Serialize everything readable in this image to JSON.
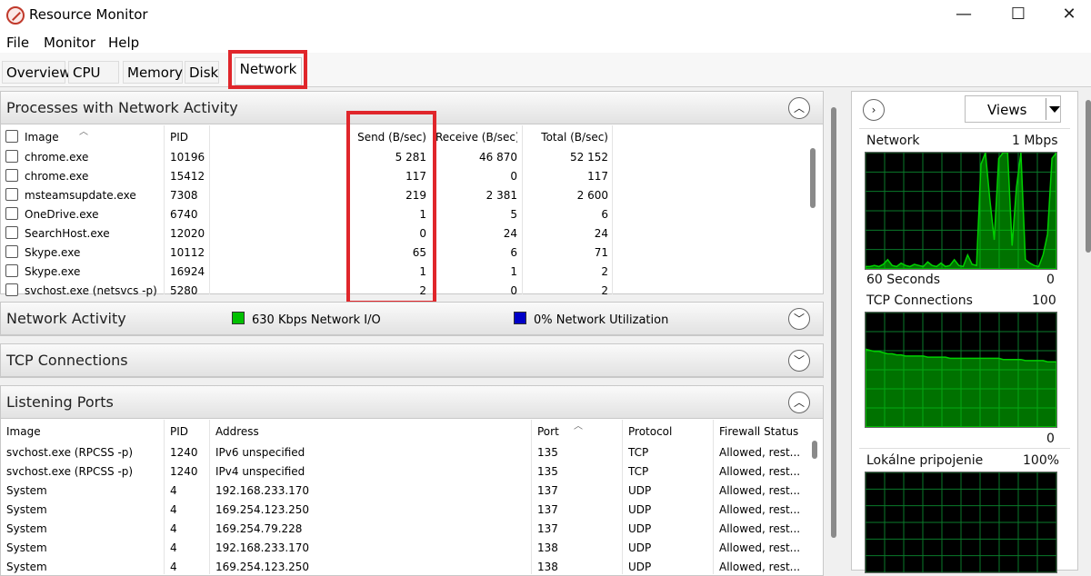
{
  "window": {
    "title": "Resource Monitor",
    "minimize": "—",
    "maximize": "☐",
    "close": "✕"
  },
  "menu": [
    "File",
    "Monitor",
    "Help"
  ],
  "tabs": [
    "Overview",
    "CPU",
    "Memory",
    "Disk",
    "Network"
  ],
  "processes": {
    "title": "Processes with Network Activity",
    "columns": [
      "Image",
      "PID",
      "Send (B/sec)",
      "Receive (B/sec)",
      "Total (B/sec)"
    ],
    "rows": [
      [
        "chrome.exe",
        "10196",
        "5 281",
        "46 870",
        "52 152"
      ],
      [
        "chrome.exe",
        "15412",
        "117",
        "0",
        "117"
      ],
      [
        "msteamsupdate.exe",
        "7308",
        "219",
        "2 381",
        "2 600"
      ],
      [
        "OneDrive.exe",
        "6740",
        "1",
        "5",
        "6"
      ],
      [
        "SearchHost.exe",
        "12020",
        "0",
        "24",
        "24"
      ],
      [
        "Skype.exe",
        "10112",
        "65",
        "6",
        "71"
      ],
      [
        "Skype.exe",
        "16924",
        "1",
        "1",
        "2"
      ],
      [
        "svchost.exe (netsvcs -p)",
        "5280",
        "2",
        "0",
        "2"
      ]
    ]
  },
  "network_activity": {
    "title": "Network Activity",
    "io": "630 Kbps Network I/O",
    "util": "0% Network Utilization",
    "io_color": "#00c000",
    "util_color": "#0000c8"
  },
  "tcp": {
    "title": "TCP Connections"
  },
  "listening": {
    "title": "Listening Ports",
    "columns": [
      "Image",
      "PID",
      "Address",
      "Port",
      "Protocol",
      "Firewall Status"
    ],
    "rows": [
      [
        "svchost.exe (RPCSS -p)",
        "1240",
        "IPv6 unspecified",
        "135",
        "TCP",
        "Allowed, rest..."
      ],
      [
        "svchost.exe (RPCSS -p)",
        "1240",
        "IPv4 unspecified",
        "135",
        "TCP",
        "Allowed, rest..."
      ],
      [
        "System",
        "4",
        "192.168.233.170",
        "137",
        "UDP",
        "Allowed, rest..."
      ],
      [
        "System",
        "4",
        "169.254.123.250",
        "137",
        "UDP",
        "Allowed, rest..."
      ],
      [
        "System",
        "4",
        "169.254.79.228",
        "137",
        "UDP",
        "Allowed, rest..."
      ],
      [
        "System",
        "4",
        "192.168.233.170",
        "138",
        "UDP",
        "Allowed, rest..."
      ],
      [
        "System",
        "4",
        "169.254.123.250",
        "138",
        "UDP",
        "Allowed, rest..."
      ]
    ]
  },
  "right": {
    "views": "Views",
    "network_label": "Network",
    "network_scale": "1 Mbps",
    "seconds": "60 Seconds",
    "network_min": "0",
    "tcp_label": "TCP Connections",
    "tcp_scale": "100",
    "tcp_min": "0",
    "local_label": "Lokálne pripojenie",
    "local_scale": "100%",
    "network_series": [
      2,
      2,
      3,
      2,
      4,
      8,
      3,
      2,
      5,
      3,
      2,
      4,
      3,
      2,
      6,
      3,
      2,
      5,
      2,
      3,
      8,
      3,
      2,
      12,
      4,
      3,
      90,
      100,
      60,
      25,
      95,
      100,
      100,
      20,
      70,
      100,
      8,
      5,
      3,
      2,
      12,
      30,
      95,
      100
    ],
    "tcp_series": [
      68,
      67,
      66,
      66,
      65,
      64,
      64,
      63,
      63,
      62,
      62,
      62,
      62,
      62,
      61,
      61,
      61,
      61,
      61,
      60,
      60,
      60,
      60,
      60,
      60,
      60,
      60,
      60,
      60,
      60,
      60,
      59,
      59,
      59,
      59,
      59,
      58,
      58,
      58,
      58,
      58,
      57,
      57,
      57
    ],
    "graph_color": "#00d000"
  }
}
